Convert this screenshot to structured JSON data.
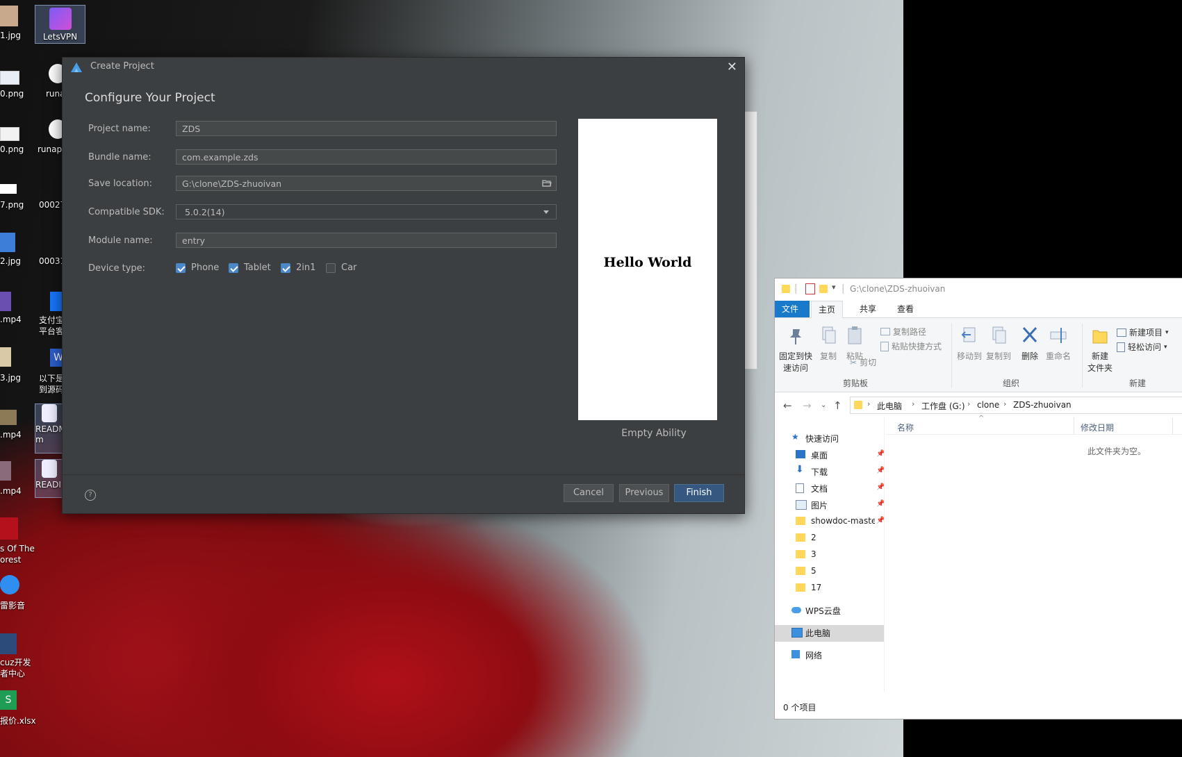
{
  "desktop": {
    "icons": [
      {
        "label": "LetsVPN"
      },
      {
        "label": "1.jpg"
      },
      {
        "label": "0.png"
      },
      {
        "label": "runa"
      },
      {
        "label": "0.png"
      },
      {
        "label": "runap"
      },
      {
        "label": "7.png"
      },
      {
        "label": "00027"
      },
      {
        "label": "2.jpg"
      },
      {
        "label": "00031"
      },
      {
        "label": ".mp4"
      },
      {
        "label": "支付宝\n平台客"
      },
      {
        "label": "3.jpg"
      },
      {
        "label": "以下是\n到源码"
      },
      {
        "label": ".mp4"
      },
      {
        "label": "READM\nm"
      },
      {
        "label": ".mp4"
      },
      {
        "label": "READI"
      },
      {
        "label": "s Of The\norest"
      },
      {
        "label": "雷影音"
      },
      {
        "label": "cuz开发\n者中心"
      },
      {
        "label": "报价.xlsx"
      }
    ]
  },
  "dialog": {
    "title": "Create Project",
    "heading": "Configure Your Project",
    "fields": {
      "project_name": {
        "label": "Project name:",
        "value": "ZDS"
      },
      "bundle_name": {
        "label": "Bundle name:",
        "value": "com.example.zds"
      },
      "save_location": {
        "label": "Save location:",
        "value": "G:\\clone\\ZDS-zhuoivan"
      },
      "compatible_sdk": {
        "label": "Compatible SDK:",
        "value": "5.0.2(14)"
      },
      "module_name": {
        "label": "Module name:",
        "value": "entry"
      }
    },
    "device_type": {
      "label": "Device type:",
      "options": [
        {
          "label": "Phone",
          "checked": true
        },
        {
          "label": "Tablet",
          "checked": true
        },
        {
          "label": "2in1",
          "checked": true
        },
        {
          "label": "Car",
          "checked": false
        }
      ]
    },
    "preview": {
      "text": "Hello World",
      "caption": "Empty Ability"
    },
    "buttons": {
      "help": "?",
      "cancel": "Cancel",
      "previous": "Previous",
      "finish": "Finish"
    }
  },
  "explorer": {
    "title_path": "G:\\clone\\ZDS-zhuoivan",
    "tabs": [
      "文件",
      "主页",
      "共享",
      "查看"
    ],
    "ribbon": {
      "pin": "固定到快\n速访问",
      "copy": "复制",
      "paste": "粘贴",
      "copy_path": "复制路径",
      "paste_shortcut": "粘贴快捷方式",
      "cut": "剪切",
      "group_clipboard": "剪贴板",
      "move_to": "移动到",
      "copy_to": "复制到",
      "delete": "删除",
      "rename": "重命名",
      "group_organize": "组织",
      "new_folder": "新建\n文件夹",
      "new_item": "新建项目",
      "easy_access": "轻松访问",
      "group_new": "新建"
    },
    "breadcrumb": [
      "此电脑",
      "工作盘 (G:)",
      "clone",
      "ZDS-zhuoivan"
    ],
    "nav": {
      "quick_access": "快速访问",
      "items": [
        {
          "label": "桌面",
          "pinned": true
        },
        {
          "label": "下载",
          "pinned": true
        },
        {
          "label": "文档",
          "pinned": true
        },
        {
          "label": "图片",
          "pinned": true
        },
        {
          "label": "showdoc-maste",
          "pinned": true
        },
        {
          "label": "2",
          "pinned": false
        },
        {
          "label": "3",
          "pinned": false
        },
        {
          "label": "5",
          "pinned": false
        },
        {
          "label": "17",
          "pinned": false
        }
      ],
      "wps": "WPS云盘",
      "this_pc": "此电脑",
      "network": "网络"
    },
    "columns": {
      "name": "名称",
      "modified": "修改日期"
    },
    "empty_text": "此文件夹为空。",
    "status": "0 个项目"
  },
  "colors": {
    "dialog_bg": "#3c3f41",
    "accent": "#4a88c7",
    "finish_button": "#365880",
    "explorer_file_tab": "#1979ca"
  }
}
